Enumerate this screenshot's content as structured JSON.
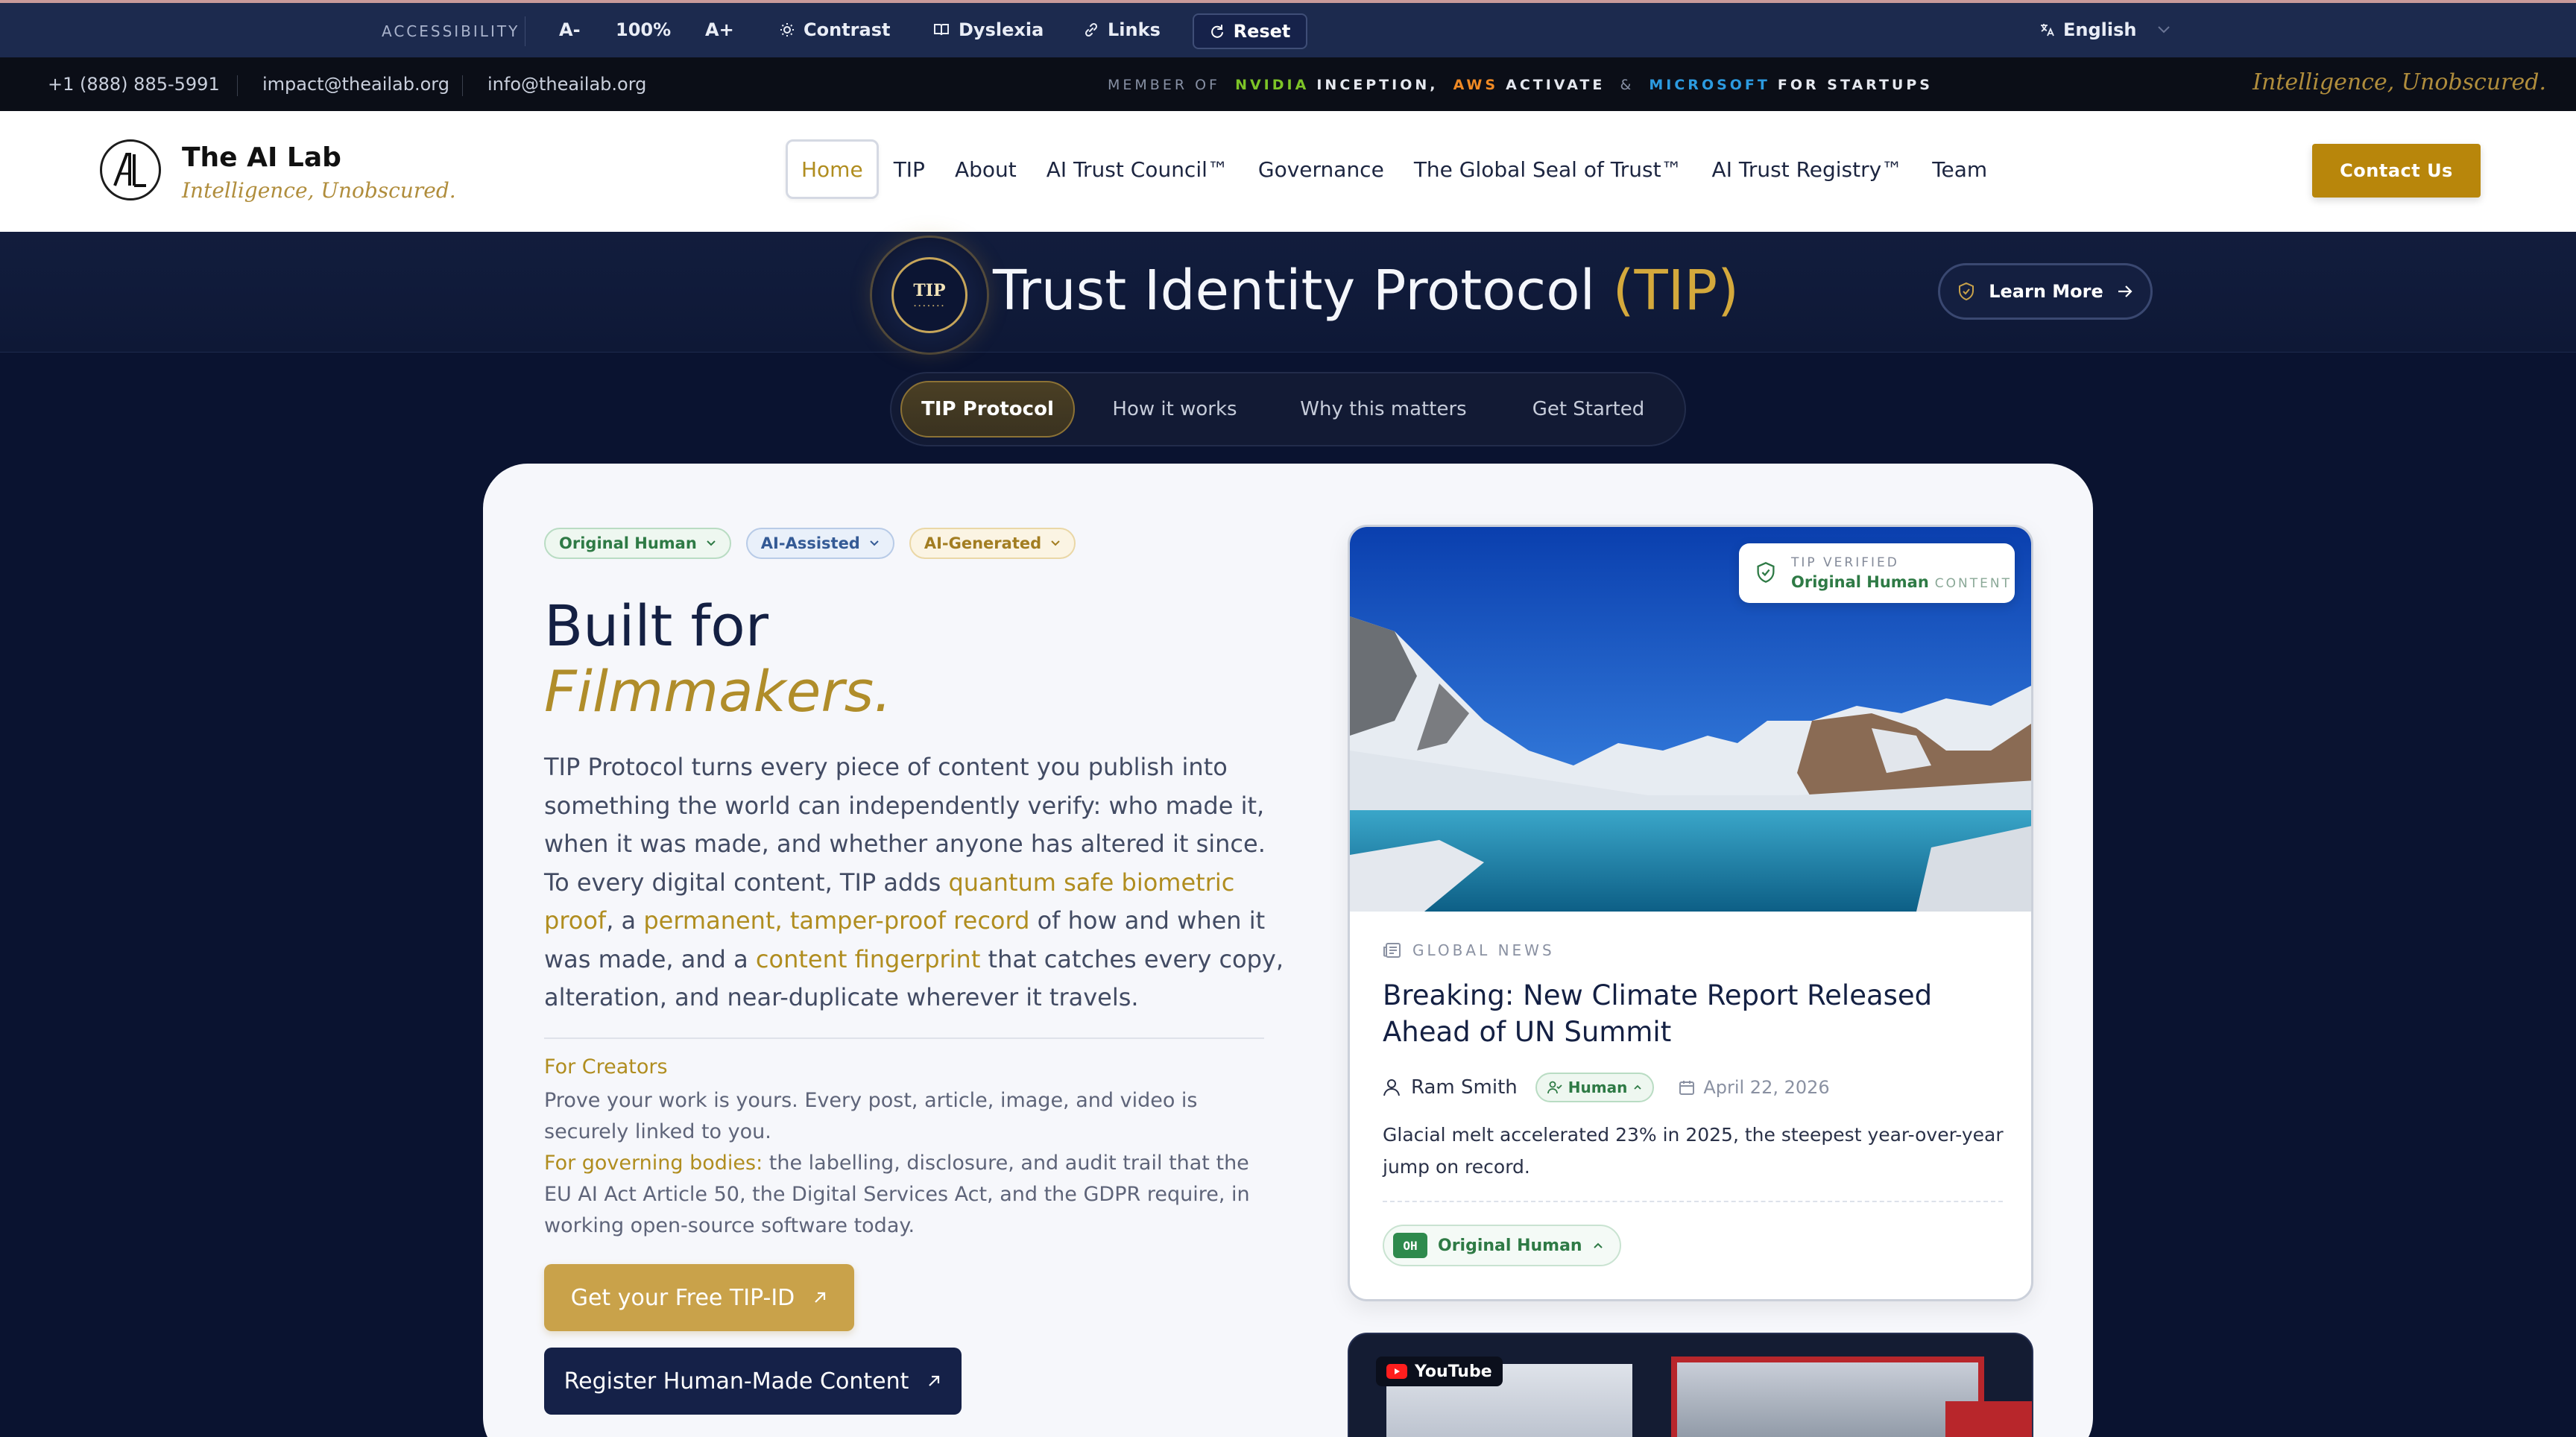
{
  "accessibility": {
    "label": "ACCESSIBILITY",
    "decrease": "A-",
    "zoom": "100%",
    "increase": "A+",
    "contrast": "Contrast",
    "dyslexia": "Dyslexia",
    "links": "Links",
    "reset": "Reset",
    "language": "English"
  },
  "contact": {
    "phone": "+1 (888) 885-5991",
    "email_impact": "impact@theailab.org",
    "email_info": "info@theailab.org",
    "member_of": "MEMBER OF",
    "nvidia": "NVIDIA",
    "inception": "INCEPTION,",
    "aws": "AWS",
    "activate": "ACTIVATE",
    "amp": "&",
    "microsoft": "MICROSOFT",
    "for_startups": "FOR STARTUPS",
    "tagline": "Intelligence, Unobscured."
  },
  "nav": {
    "brand": "The AI Lab",
    "brand_tag": "Intelligence, Unobscured.",
    "links": [
      "Home",
      "TIP",
      "About",
      "AI Trust Council™",
      "Governance",
      "The Global Seal of Trust™",
      "AI Trust Registry™",
      "Team"
    ],
    "contact_btn": "Contact Us"
  },
  "hero": {
    "seal_text": "TIP",
    "title": "Trust Identity Protocol",
    "title_accent": "(TIP)",
    "learn_more": "Learn More"
  },
  "tabs": [
    "TIP Protocol",
    "How it works",
    "Why this matters",
    "Get Started"
  ],
  "main": {
    "chips": [
      "Original Human",
      "AI-Assisted",
      "AI-Generated"
    ],
    "title_line1": "Built for",
    "title_line2": "Filmmakers.",
    "desc": {
      "p1": "TIP Protocol turns every piece of content you publish into something the world can independently verify: who made it, when it was made, and whether anyone has altered it since. To every digital content, TIP adds ",
      "l1": "quantum safe biometric proof",
      "p2": ", a ",
      "l2": "permanent, tamper-proof record",
      "p3": " of how and when it was made, and a ",
      "l3": "content fingerprint",
      "p4": " that catches every copy, alteration, and near-duplicate wherever it travels."
    },
    "creators_head": "For Creators",
    "creators_body": "Prove your work is yours. Every post, article, image, and video is securely linked to you.",
    "gov_head": "For governing bodies:",
    "gov_body": " the labelling, disclosure, and audit trail that the EU AI Act Article 50, the Digital Services Act, and the GDPR require, in working open-source software today.",
    "cta_primary": "Get your Free TIP-ID",
    "cta_secondary": "Register Human-Made Content"
  },
  "article": {
    "verified_small": "TIP VERIFIED",
    "verified_main": "Original Human",
    "verified_suffix": "CONTENT",
    "category": "GLOBAL NEWS",
    "title": "Breaking: New Climate Report Released Ahead of UN Summit",
    "author": "Ram Smith",
    "author_badge": "Human",
    "date": "April 22, 2026",
    "body": "Glacial melt accelerated 23% in 2025, the steepest year-over-year jump on record.",
    "oh_code": "OH",
    "oh_label": "Original Human"
  },
  "youtube": {
    "label": "YouTube"
  }
}
